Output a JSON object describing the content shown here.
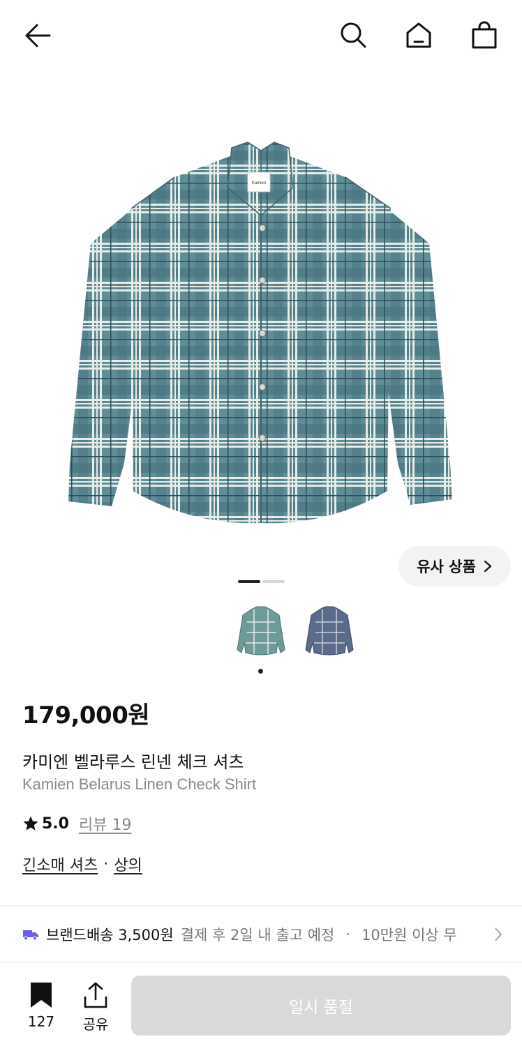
{
  "header": {
    "back_icon": "arrow-left-icon",
    "search_icon": "search-icon",
    "home_icon": "home-icon",
    "cart_icon": "shopping-bag-icon"
  },
  "gallery": {
    "label_on_garment": "Kamien",
    "similar_button": "유사 상품",
    "page_indicator": {
      "current": 1,
      "total": 2
    }
  },
  "color_options": {
    "selected_index": 0,
    "swatches": [
      "green-check",
      "blue-check"
    ]
  },
  "product": {
    "price": "179,000원",
    "name_ko": "카미엔 벨라루스 린넨 체크 셔츠",
    "name_en": "Kamien Belarus Linen Check Shirt",
    "rating": "5.0",
    "review_label": "리뷰 19",
    "category_1": "긴소매 셔츠",
    "category_sep": "·",
    "category_2": "상의"
  },
  "shipping": {
    "icon": "truck-icon",
    "label": "브랜드배송 3,500원",
    "detail": "결제 후 2일 내 출고 예정",
    "sep": "·",
    "extra": "10만원 이상 무"
  },
  "bottom": {
    "bookmark_count": "127",
    "share_label": "공유",
    "cta": "일시 품절"
  },
  "colors": {
    "accent_truck": "#6b5cf0",
    "disabled_button": "#d9d9d9"
  }
}
